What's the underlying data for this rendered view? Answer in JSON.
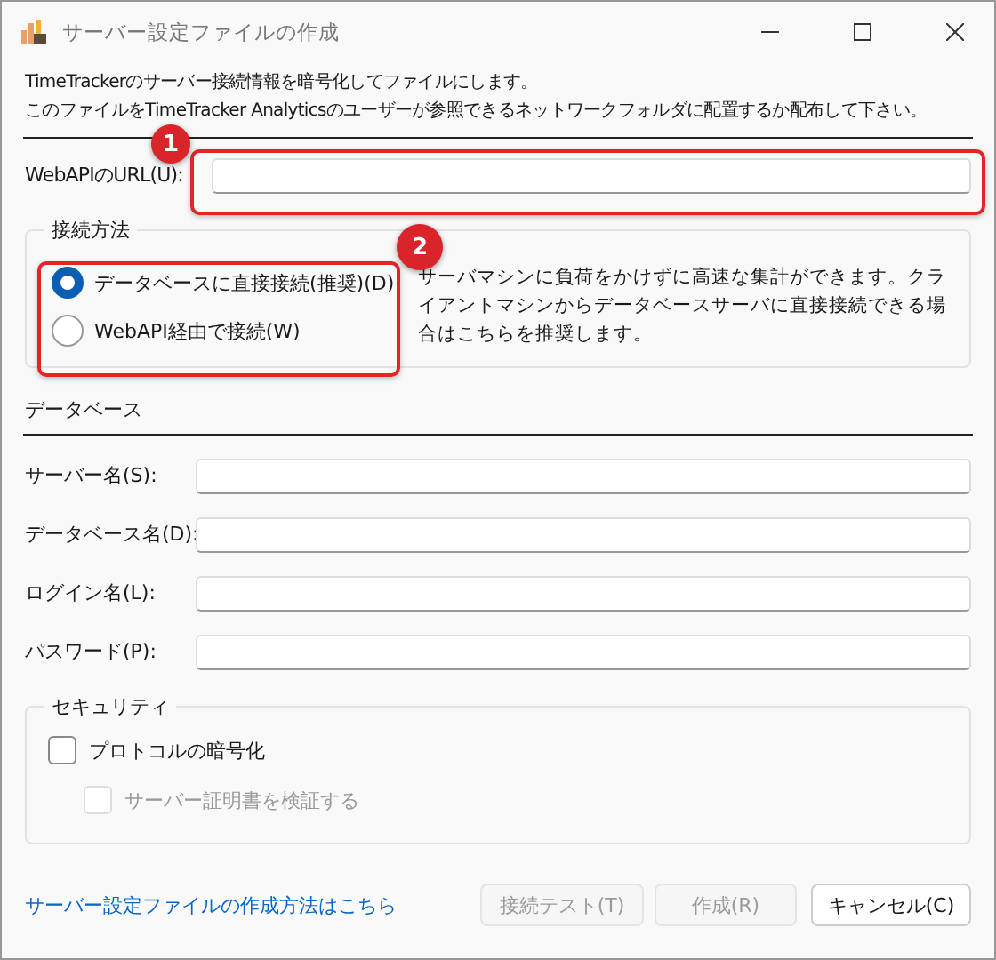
{
  "window": {
    "title": "サーバー設定ファイルの作成"
  },
  "intro": [
    "TimeTrackerのサーバー接続情報を暗号化してファイルにします。",
    "このファイルをTimeTracker Analyticsのユーザーが参照できるネットワークフォルダに配置するか配布して下さい。"
  ],
  "webapi_url": {
    "label": "WebAPIのURL(U):"
  },
  "connection": {
    "title": "接続方法",
    "options": [
      {
        "label": "データベースに直接接続(推奨)(D)",
        "selected": true
      },
      {
        "label": "WebAPI経由で接続(W)",
        "selected": false
      }
    ],
    "description": "サーバマシンに負荷をかけずに高速な集計ができます。クライアントマシンからデータベースサーバに直接接続できる場合はこちらを推奨します。"
  },
  "database": {
    "title": "データベース",
    "fields": [
      {
        "label": "サーバー名(S):"
      },
      {
        "label": "データベース名(D):"
      },
      {
        "label": "ログイン名(L):"
      },
      {
        "label": "パスワード(P):"
      }
    ]
  },
  "security": {
    "title": "セキュリティ",
    "options": [
      {
        "label": "プロトコルの暗号化",
        "checked": false,
        "disabled": false
      },
      {
        "label": "サーバー証明書を検証する",
        "checked": false,
        "disabled": true
      }
    ]
  },
  "help_link": "サーバー設定ファイルの作成方法はこちら",
  "buttons": [
    {
      "label": "接続テスト(T)",
      "disabled": true
    },
    {
      "label": "作成(R)",
      "disabled": true
    },
    {
      "label": "キャンセル(C)",
      "disabled": false
    }
  ],
  "callouts": [
    {
      "label": "1"
    },
    {
      "label": "2"
    }
  ]
}
